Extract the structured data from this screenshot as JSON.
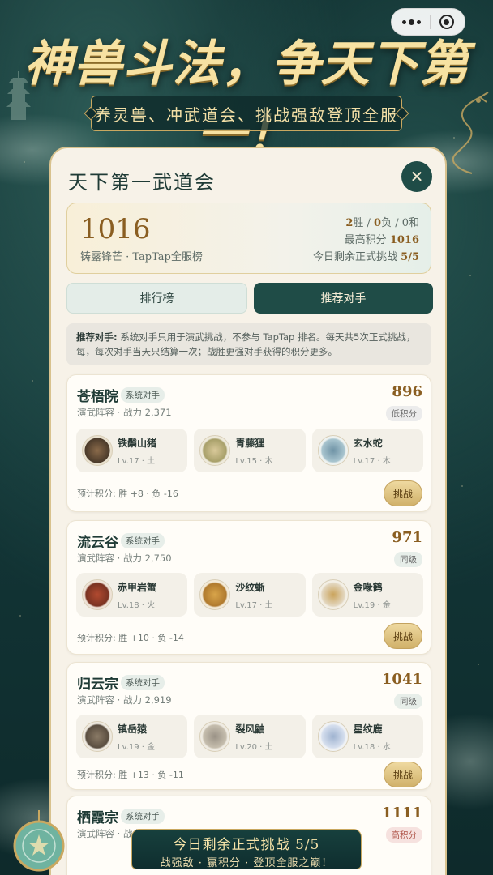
{
  "header": {
    "headline": "神兽斗法，争天下第一！",
    "subtitle": "养灵兽、冲武道会、挑战强敌登顶全服"
  },
  "panel": {
    "title": "天下第一武道会",
    "close_icon": "close-icon"
  },
  "score": {
    "value": "1016",
    "label": "铸露锋芒 · TapTap全服榜",
    "wins": "2",
    "wins_suffix": "胜 / ",
    "losses": "0",
    "losses_suffix": "负 / 0和",
    "best_label": "最高积分",
    "best_value": "1016",
    "remaining_label": "今日剩余正式挑战",
    "remaining_value": "5/5"
  },
  "tabs": [
    {
      "label": "排行榜",
      "active": false
    },
    {
      "label": "推荐对手",
      "active": true
    }
  ],
  "notice": {
    "bold": "推荐对手:",
    "text": " 系统对手只用于演武挑战，不参与 TapTap 排名。每天共5次正式挑战，\n每，每次对手当天只结算一次；战胜更强对手获得的积分更多。"
  },
  "opponents": [
    {
      "name": "苍梧院",
      "tag": "系统对手",
      "sub": "演武阵容 · 战力 2,371",
      "score": "896",
      "level": "低积分",
      "beasts": [
        {
          "name": "铁鬃山猪",
          "lv": "Lv.17 · 土",
          "icon": "boar-icon"
        },
        {
          "name": "青藤狸",
          "lv": "Lv.15 · 木",
          "icon": "fox-icon"
        },
        {
          "name": "玄水蛇",
          "lv": "Lv.17 · 木",
          "icon": "snake-icon"
        }
      ],
      "pred": "预计积分:  胜 +8 · 负 -16",
      "button": "挑战"
    },
    {
      "name": "流云谷",
      "tag": "系统对手",
      "sub": "演武阵容 · 战力 2,750",
      "score": "971",
      "level": "同级",
      "beasts": [
        {
          "name": "赤甲岩蟹",
          "lv": "Lv.18 · 火",
          "icon": "crab-icon"
        },
        {
          "name": "沙纹蜥",
          "lv": "Lv.17 · 土",
          "icon": "lizard-icon"
        },
        {
          "name": "金喙鹤",
          "lv": "Lv.19 · 金",
          "icon": "crane-icon"
        }
      ],
      "pred": "预计积分:  胜 +10 · 负 -14",
      "button": "挑战"
    },
    {
      "name": "归云宗",
      "tag": "系统对手",
      "sub": "演武阵容 · 战力 2,919",
      "score": "1041",
      "level": "同级",
      "beasts": [
        {
          "name": "镇岳猿",
          "lv": "Lv.19 · 金",
          "icon": "ape-icon"
        },
        {
          "name": "裂风鼬",
          "lv": "Lv.20 · 土",
          "icon": "weasel-icon"
        },
        {
          "name": "星纹鹿",
          "lv": "Lv.18 · 水",
          "icon": "deer-icon"
        }
      ],
      "pred": "预计积分:  胜 +13 · 负 -11",
      "button": "挑战"
    },
    {
      "name": "栖霞宗",
      "tag": "系统对手",
      "sub": "演武阵容 · 战力 2,937",
      "score": "1111",
      "level": "高积分",
      "beasts": [],
      "pred": "",
      "button": ""
    }
  ],
  "bottom": {
    "main": "今日剩余正式挑战 5/5",
    "sub": "战强敌 · 赢积分 · 登顶全服之巅！"
  },
  "colors": {
    "accent_dark_green": "#1f4c47",
    "gold": "#8a5e21",
    "button_gold": "#d1b16a",
    "panel_bg": "#f7f2e8"
  }
}
